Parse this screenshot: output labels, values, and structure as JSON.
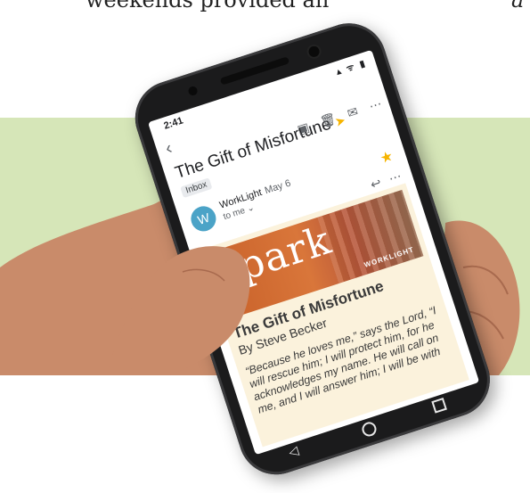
{
  "page": {
    "top_text_left": "weekends provided an",
    "top_text_right": "a"
  },
  "status": {
    "time": "2:41",
    "signals": "▴ ᯤ ▮"
  },
  "email": {
    "back_icon": "arrow-left-icon",
    "subject": "The Gift of Misfortune",
    "label": "Inbox",
    "sender_initial": "W",
    "sender_name": "WorkLight",
    "sender_date": "May 6",
    "to_line": "to me ⌄",
    "actions": [
      "archive-icon",
      "trash-icon",
      "mail-icon",
      "more-icon"
    ]
  },
  "newsletter": {
    "brand": "spark",
    "banner_logo": "WORKLIGHT",
    "title": "The Gift of Misfortune",
    "byline": "By Steve Becker",
    "quote": "“Because he loves me,” says the Lord, “I will rescue him; I will protect him, for he acknowledges my name. He will call on me, and I will answer him; I will be with"
  },
  "colors": {
    "green_band": "#d6e6b8",
    "banner": "#c9622a",
    "star": "#f6b400",
    "avatar": "#4ba3c7"
  }
}
